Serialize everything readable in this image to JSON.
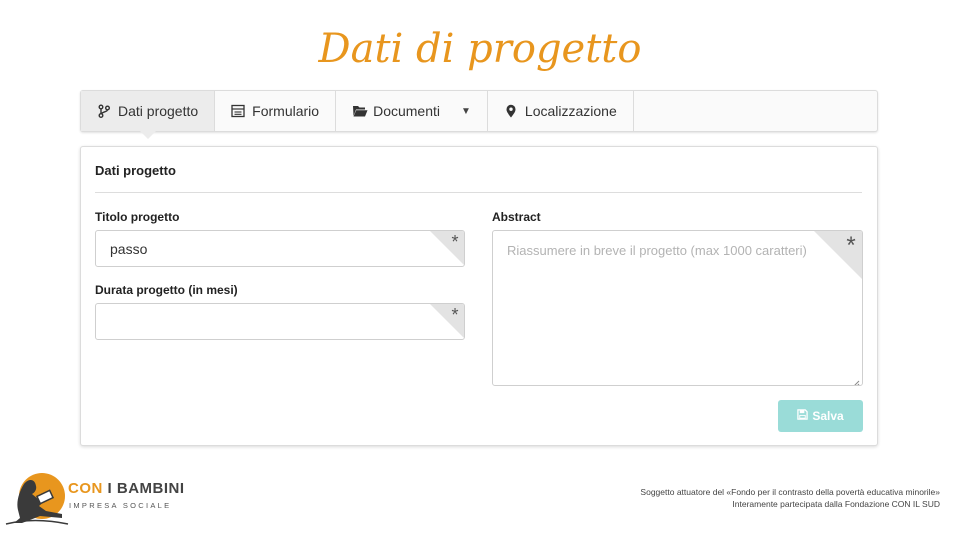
{
  "page": {
    "title": "Dati di progetto"
  },
  "tabs": [
    {
      "label": "Dati progetto",
      "icon": "branch-icon",
      "active": true
    },
    {
      "label": "Formulario",
      "icon": "form-icon",
      "active": false
    },
    {
      "label": "Documenti",
      "icon": "folder-open-icon",
      "active": false,
      "dropdown": true
    },
    {
      "label": "Localizzazione",
      "icon": "map-marker-icon",
      "active": false
    }
  ],
  "panel": {
    "title": "Dati progetto",
    "fields": {
      "titolo": {
        "label": "Titolo progetto",
        "value": "passo"
      },
      "durata": {
        "label": "Durata progetto (in mesi)",
        "value": ""
      },
      "abstract": {
        "label": "Abstract",
        "placeholder": "Riassumere in breve il progetto (max 1000 caratteri)"
      }
    },
    "save_label": "Salva"
  },
  "logo": {
    "line1_a": "CON",
    "line1_b": " I ",
    "line1_c": "BAMBINI",
    "line2": "IMPRESA SOCIALE"
  },
  "footer": {
    "line1": "Soggetto attuatore del «Fondo per il contrasto della povertà educativa minorile»",
    "line2": "Interamente partecipata dalla Fondazione CON IL SUD"
  },
  "colors": {
    "accent": "#e8961e",
    "save_button": "#9adcd8",
    "tab_active_bg": "#ececec"
  }
}
